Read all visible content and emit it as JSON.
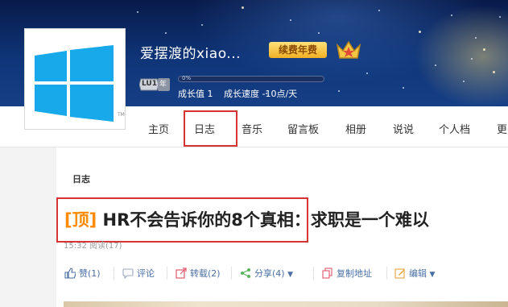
{
  "profile": {
    "nickname": "爱摆渡的xiao...",
    "vip_label": "续费年费",
    "level_label": "LU1",
    "level_suffix": "年",
    "growth_progress_percent": 0,
    "growth_progress_text": "0%",
    "growth_value": "成长值 1",
    "growth_speed": "成长速度 -10点/天"
  },
  "nav": {
    "items": [
      {
        "label": "主页"
      },
      {
        "label": "日志"
      },
      {
        "label": "音乐"
      },
      {
        "label": "留言板"
      },
      {
        "label": "相册"
      },
      {
        "label": "说说"
      },
      {
        "label": "个人档"
      },
      {
        "label": "更"
      }
    ],
    "active_index": 1
  },
  "content": {
    "section_title": "日志",
    "post": {
      "tag": "[顶]",
      "title": " HR不会告诉你的8个真相：求职是一个难以",
      "meta": "15:32  阅读(17)"
    },
    "actions": [
      {
        "label": "赞(1)",
        "icon": "thumbs-up-icon"
      },
      {
        "label": "评论",
        "icon": "comment-icon"
      },
      {
        "label": "转载(2)",
        "icon": "share-arrow-icon"
      },
      {
        "label": "分享(4)",
        "icon": "share-nodes-icon"
      },
      {
        "label": "复制地址",
        "icon": "copy-icon"
      },
      {
        "label": "编辑",
        "icon": "edit-icon"
      }
    ]
  },
  "colors": {
    "accent_orange": "#ff8a00",
    "highlight_red": "#d63333",
    "link_blue": "#4a6fa5",
    "banner_dark": "#0f3578"
  }
}
